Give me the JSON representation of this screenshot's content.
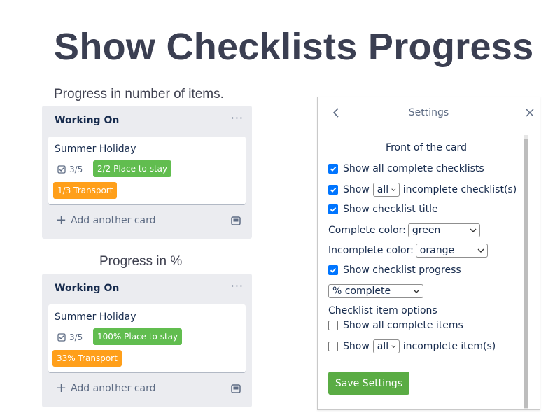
{
  "page": {
    "title": "Show Checklists Progress"
  },
  "examples": [
    {
      "caption": "Progress in number of items.",
      "list_title": "Working On",
      "menu_glyph": "···",
      "card_title": "Summer Holiday",
      "checklist_badge": "3/5",
      "labels": [
        {
          "text": "2/2 Place to stay",
          "color": "#61bd4f"
        },
        {
          "text": "1/3 Transport",
          "color": "#ff9f1a"
        }
      ],
      "add_card": "Add another card"
    },
    {
      "caption": "Progress in %",
      "list_title": "Working On",
      "menu_glyph": "···",
      "card_title": "Summer Holiday",
      "checklist_badge": "3/5",
      "labels": [
        {
          "text": "100% Place to stay",
          "color": "#61bd4f"
        },
        {
          "text": "33% Transport",
          "color": "#ff9f1a"
        }
      ],
      "add_card": "Add another card"
    }
  ],
  "settings": {
    "title": "Settings",
    "section": "Front of the card",
    "show_all_complete": {
      "label": "Show all complete checklists",
      "checked": true
    },
    "show_incomplete": {
      "prefix": "Show",
      "select": "all",
      "suffix": "incomplete checklist(s)",
      "checked": true
    },
    "show_title": {
      "label": "Show checklist title",
      "checked": true
    },
    "complete_color": {
      "label": "Complete color:",
      "value": "green"
    },
    "incomplete_color": {
      "label": "Incomplete color:",
      "value": "orange"
    },
    "show_progress": {
      "label": "Show checklist progress",
      "checked": true
    },
    "progress_mode": {
      "value": "% complete"
    },
    "item_options": {
      "heading": "Checklist item options",
      "show_all_complete_items": {
        "label": "Show all complete items",
        "checked": false
      },
      "show_incomplete_items": {
        "prefix": "Show",
        "select": "all",
        "suffix": "incomplete item(s)",
        "checked": false
      }
    },
    "save_label": "Save Settings"
  },
  "colors": {
    "green": "#61bd4f",
    "orange": "#ff9f1a",
    "save": "#5aac44",
    "checkbox": "#0075ff"
  }
}
